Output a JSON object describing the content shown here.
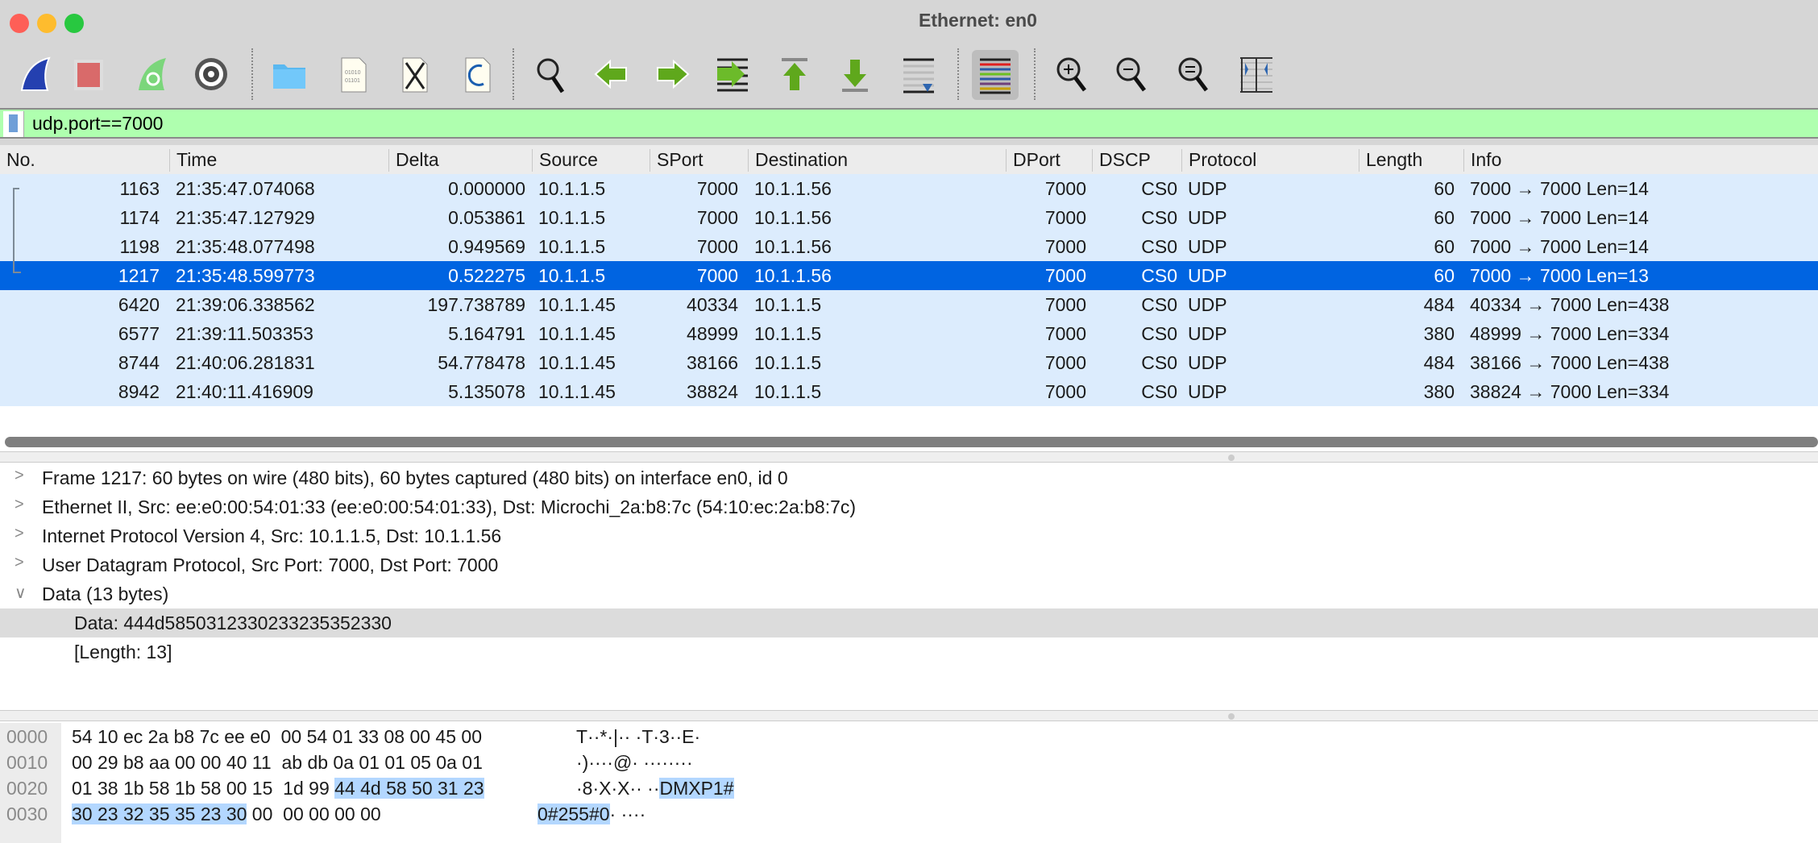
{
  "window": {
    "title": "Ethernet: en0"
  },
  "toolbar": {
    "items": [
      {
        "name": "start-capture-icon"
      },
      {
        "name": "stop-capture-icon"
      },
      {
        "name": "restart-capture-icon"
      },
      {
        "name": "capture-options-icon"
      },
      {
        "name": "open-file-icon"
      },
      {
        "name": "save-file-icon"
      },
      {
        "name": "close-file-icon"
      },
      {
        "name": "reload-file-icon"
      },
      {
        "name": "find-packet-icon"
      },
      {
        "name": "go-back-icon"
      },
      {
        "name": "go-forward-icon"
      },
      {
        "name": "go-to-packet-icon"
      },
      {
        "name": "first-packet-icon"
      },
      {
        "name": "last-packet-icon"
      },
      {
        "name": "auto-scroll-icon"
      },
      {
        "name": "colorize-icon"
      },
      {
        "name": "zoom-in-icon"
      },
      {
        "name": "zoom-out-icon"
      },
      {
        "name": "normal-size-icon"
      },
      {
        "name": "resize-columns-icon"
      }
    ]
  },
  "filter": {
    "value": "udp.port==7000"
  },
  "packet_list": {
    "columns": [
      "No.",
      "Time",
      "Delta",
      "Source",
      "SPort",
      "Destination",
      "DPort",
      "DSCP",
      "Protocol",
      "Length",
      "Info"
    ],
    "rows": [
      [
        "1163",
        "21:35:47.074068",
        "0.000000",
        "10.1.1.5",
        "7000",
        "10.1.1.56",
        "7000",
        "CS0",
        "UDP",
        "60",
        "7000 → 7000 Len=14"
      ],
      [
        "1174",
        "21:35:47.127929",
        "0.053861",
        "10.1.1.5",
        "7000",
        "10.1.1.56",
        "7000",
        "CS0",
        "UDP",
        "60",
        "7000 → 7000 Len=14"
      ],
      [
        "1198",
        "21:35:48.077498",
        "0.949569",
        "10.1.1.5",
        "7000",
        "10.1.1.56",
        "7000",
        "CS0",
        "UDP",
        "60",
        "7000 → 7000 Len=14"
      ],
      [
        "1217",
        "21:35:48.599773",
        "0.522275",
        "10.1.1.5",
        "7000",
        "10.1.1.56",
        "7000",
        "CS0",
        "UDP",
        "60",
        "7000 → 7000 Len=13"
      ],
      [
        "6420",
        "21:39:06.338562",
        "197.738789",
        "10.1.1.45",
        "40334",
        "10.1.1.5",
        "7000",
        "CS0",
        "UDP",
        "484",
        "40334 → 7000 Len=438"
      ],
      [
        "6577",
        "21:39:11.503353",
        "5.164791",
        "10.1.1.45",
        "48999",
        "10.1.1.5",
        "7000",
        "CS0",
        "UDP",
        "380",
        "48999 → 7000 Len=334"
      ],
      [
        "8744",
        "21:40:06.281831",
        "54.778478",
        "10.1.1.45",
        "38166",
        "10.1.1.5",
        "7000",
        "CS0",
        "UDP",
        "484",
        "38166 → 7000 Len=438"
      ],
      [
        "8942",
        "21:40:11.416909",
        "5.135078",
        "10.1.1.45",
        "38824",
        "10.1.1.5",
        "7000",
        "CS0",
        "UDP",
        "380",
        "38824 → 7000 Len=334"
      ]
    ],
    "selected_row": 3
  },
  "details": [
    {
      "text": "Frame 1217: 60 bytes on wire (480 bits), 60 bytes captured (480 bits) on interface en0, id 0",
      "chev": ">"
    },
    {
      "text": "Ethernet II, Src: ee:e0:00:54:01:33 (ee:e0:00:54:01:33), Dst: Microchi_2a:b8:7c (54:10:ec:2a:b8:7c)",
      "chev": ">"
    },
    {
      "text": "Internet Protocol Version 4, Src: 10.1.1.5, Dst: 10.1.1.56",
      "chev": ">"
    },
    {
      "text": "User Datagram Protocol, Src Port: 7000, Dst Port: 7000",
      "chev": ">"
    },
    {
      "text": "Data (13 bytes)",
      "chev": "∨"
    },
    {
      "text": "Data: 444d5850312330233235352330",
      "chev": ""
    },
    {
      "text": "[Length: 13]",
      "chev": ""
    }
  ],
  "hex": [
    {
      "off": "0000",
      "hex": "54 10 ec 2a b8 7c ee e0  00 54 01 33 08 00 45 00",
      "hexhl": "",
      "hexrest": "",
      "asc": "T··*·|·· ·T·3··E·",
      "aschl": "",
      "ascrest": ""
    },
    {
      "off": "0010",
      "hex": "00 29 b8 aa 00 00 40 11  ab db 0a 01 01 05 0a 01",
      "hexhl": "",
      "hexrest": "",
      "asc": "·)····@· ········",
      "aschl": "",
      "ascrest": ""
    },
    {
      "off": "0020",
      "hex": "01 38 1b 58 1b 58 00 15  1d 99 ",
      "hexhl": "44 4d 58 50 31 23",
      "hexrest": "",
      "asc": "·8·X·X·· ··",
      "aschl": "DMXP1#",
      "ascrest": ""
    },
    {
      "off": "0030",
      "hex": "",
      "hexhl": "30 23 32 35 35 23 30",
      "hexrest": " 00  00 00 00 00",
      "asc": "",
      "aschl": "0#255#0",
      "ascrest": "· ····"
    }
  ]
}
